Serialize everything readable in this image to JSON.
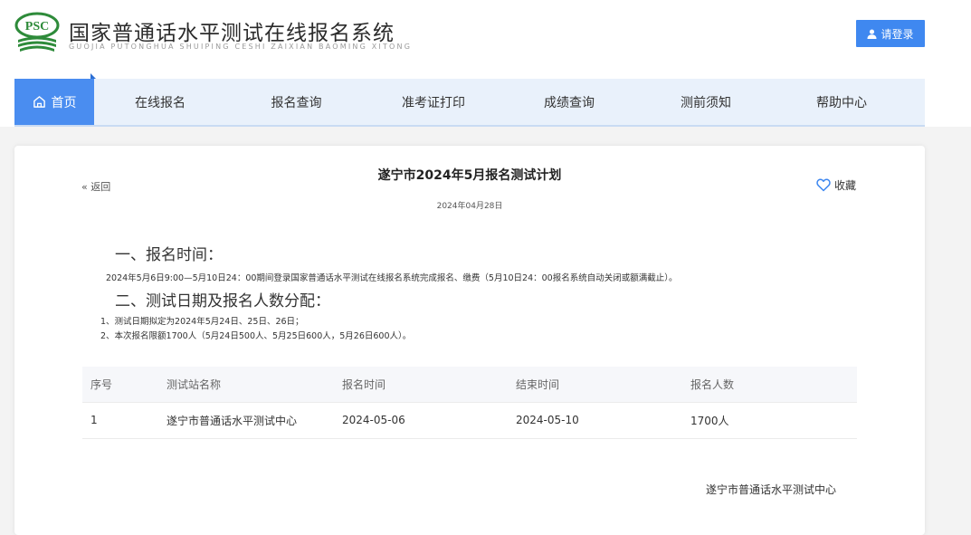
{
  "header": {
    "logo_text": "PSC",
    "title": "国家普通话水平测试在线报名系统",
    "subtitle": "GUOJIA PUTONGHUA SHUIPING CESHI ZAIXIAN BAOMING XITONG",
    "login_label": "请登录"
  },
  "nav": {
    "items": [
      {
        "label": "首页"
      },
      {
        "label": "在线报名"
      },
      {
        "label": "报名查询"
      },
      {
        "label": "准考证打印"
      },
      {
        "label": "成绩查询"
      },
      {
        "label": "测前须知"
      },
      {
        "label": "帮助中心"
      }
    ]
  },
  "article": {
    "back_label": "« 返回",
    "collect_label": "收藏",
    "title": "遂宁市2024年5月报名测试计划",
    "date": "2024年04月28日",
    "section1_heading": "一、报名时间：",
    "section1_text": "2024年5月6日9:00—5月10日24：00期间登录国家普通话水平测试在线报名系统完成报名、缴费（5月10日24：00报名系统自动关闭或额满截止）。",
    "section2_heading": "二、测试日期及报名人数分配：",
    "section2_item1": "1、测试日期拟定为2024年5月24日、25日、26日；",
    "section2_item2": "2、本次报名限额1700人（5月24日500人、5月25日600人，5月26日600人）。",
    "signature": "遂宁市普通话水平测试中心"
  },
  "table": {
    "headers": [
      "序号",
      "测试站名称",
      "报名时间",
      "结束时间",
      "报名人数"
    ],
    "rows": [
      [
        "1",
        "遂宁市普通话水平测试中心",
        "2024-05-06",
        "2024-05-10",
        "1700人"
      ]
    ]
  },
  "colors": {
    "accent": "#4a8df0",
    "nav_bg": "#e9f1fb",
    "logo_green": "#2e8b3a"
  }
}
